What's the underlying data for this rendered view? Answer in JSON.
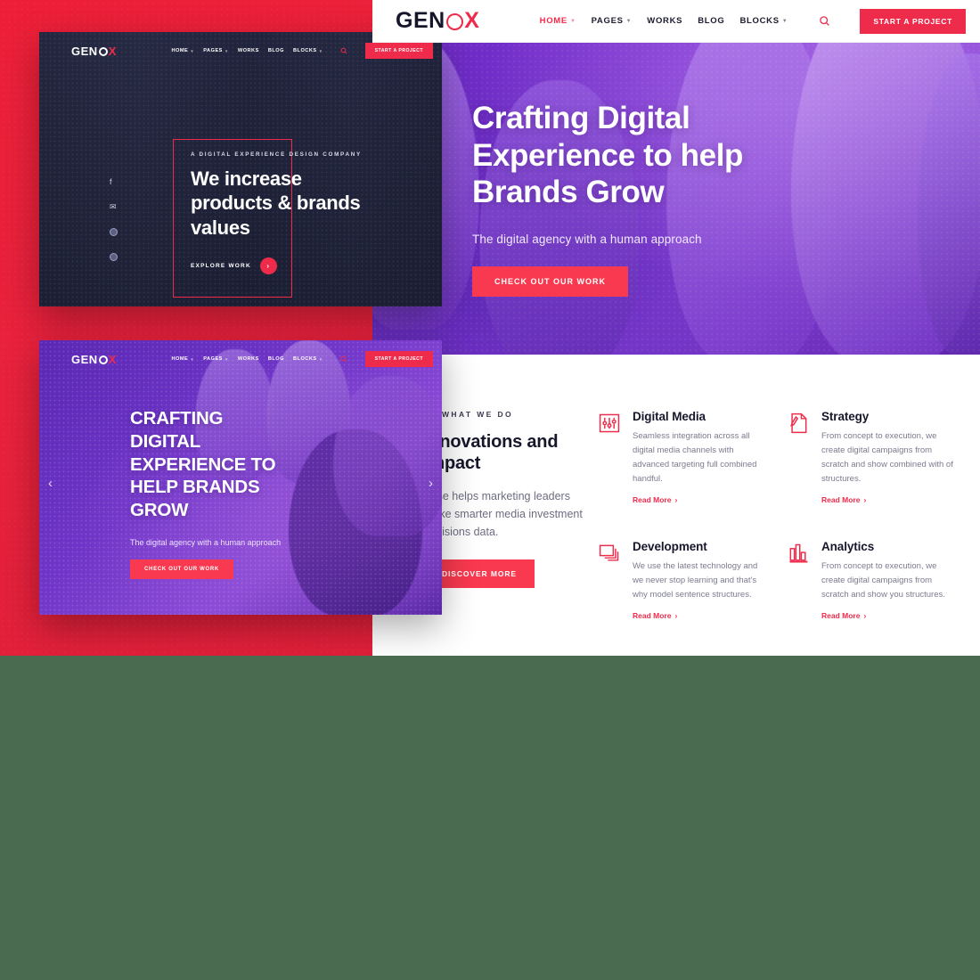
{
  "brand": {
    "name_part1": "GEN",
    "name_circle": "O",
    "name_part2": "X",
    "accent": "#ef2b4b",
    "purple": "#7b34cf",
    "dark": "#1d2038"
  },
  "main_nav": {
    "items": [
      {
        "label": "HOME",
        "has_caret": true,
        "active": true
      },
      {
        "label": "PAGES",
        "has_caret": true,
        "active": false
      },
      {
        "label": "WORKS",
        "has_caret": false,
        "active": false
      },
      {
        "label": "BLOG",
        "has_caret": false,
        "active": false
      },
      {
        "label": "BLOCKS",
        "has_caret": true,
        "active": false
      }
    ],
    "search_icon": "search-icon",
    "cta_label": "START A PROJECT"
  },
  "main_hero": {
    "heading_lines": [
      "Crafting Digital",
      "Experience to help",
      "Brands Grow"
    ],
    "subtitle": "The digital agency with a human approach",
    "button_label": "CHECK OUT OUR WORK"
  },
  "what_we_do": {
    "eyebrow": "WHAT WE DO",
    "title_lines": [
      "Innovations and",
      "Impact"
    ],
    "text": "Wise helps marketing leaders make smarter media investment decisions data.",
    "button_label": "DISCOVER MORE",
    "services": [
      {
        "icon": "sliders-icon",
        "title": "Digital Media",
        "text": "Seamless integration across all digital media channels with advanced targeting full combined handful.",
        "link_label": "Read More"
      },
      {
        "icon": "document-pencil-icon",
        "title": "Strategy",
        "text": "From concept to execution, we create digital campaigns from scratch and show combined with of structures.",
        "link_label": "Read More"
      },
      {
        "icon": "windows-stack-icon",
        "title": "Development",
        "text": "We use the latest technology and we never stop learning and that's why model sentence structures.",
        "link_label": "Read More"
      },
      {
        "icon": "bar-chart-icon",
        "title": "Analytics",
        "text": "From concept to execution, we create digital campaigns from scratch and show you structures.",
        "link_label": "Read More"
      }
    ]
  },
  "dark_card": {
    "nav_items": [
      {
        "label": "HOME",
        "has_caret": true
      },
      {
        "label": "PAGES",
        "has_caret": true
      },
      {
        "label": "WORKS",
        "has_caret": false
      },
      {
        "label": "BLOG",
        "has_caret": false
      },
      {
        "label": "BLOCKS",
        "has_caret": true
      }
    ],
    "cta_label": "START A PROJECT",
    "socials": [
      {
        "name": "facebook-icon",
        "glyph": "f"
      },
      {
        "name": "twitter-icon",
        "glyph": "✉"
      },
      {
        "name": "social-circle-icon-1",
        "glyph": ""
      },
      {
        "name": "social-circle-icon-2",
        "glyph": ""
      }
    ],
    "eyebrow": "A DIGITAL EXPERIENCE DESIGN COMPANY",
    "heading_lines": [
      "We increase",
      "products & brands",
      "values"
    ],
    "link_label": "EXPLORE WORK",
    "arrow_glyph": "›"
  },
  "purple_card": {
    "nav_items": [
      {
        "label": "HOME",
        "has_caret": true
      },
      {
        "label": "PAGES",
        "has_caret": true
      },
      {
        "label": "WORKS",
        "has_caret": false
      },
      {
        "label": "BLOG",
        "has_caret": false
      },
      {
        "label": "BLOCKS",
        "has_caret": true
      }
    ],
    "cta_label": "START A PROJECT",
    "heading_lines": [
      "CRAFTING",
      "DIGITAL",
      "EXPERIENCE TO",
      "HELP BRANDS",
      "GROW"
    ],
    "subtitle": "The digital agency with a human approach",
    "button_label": "CHECK OUT OUR WORK",
    "prev_glyph": "‹",
    "next_glyph": "›"
  }
}
